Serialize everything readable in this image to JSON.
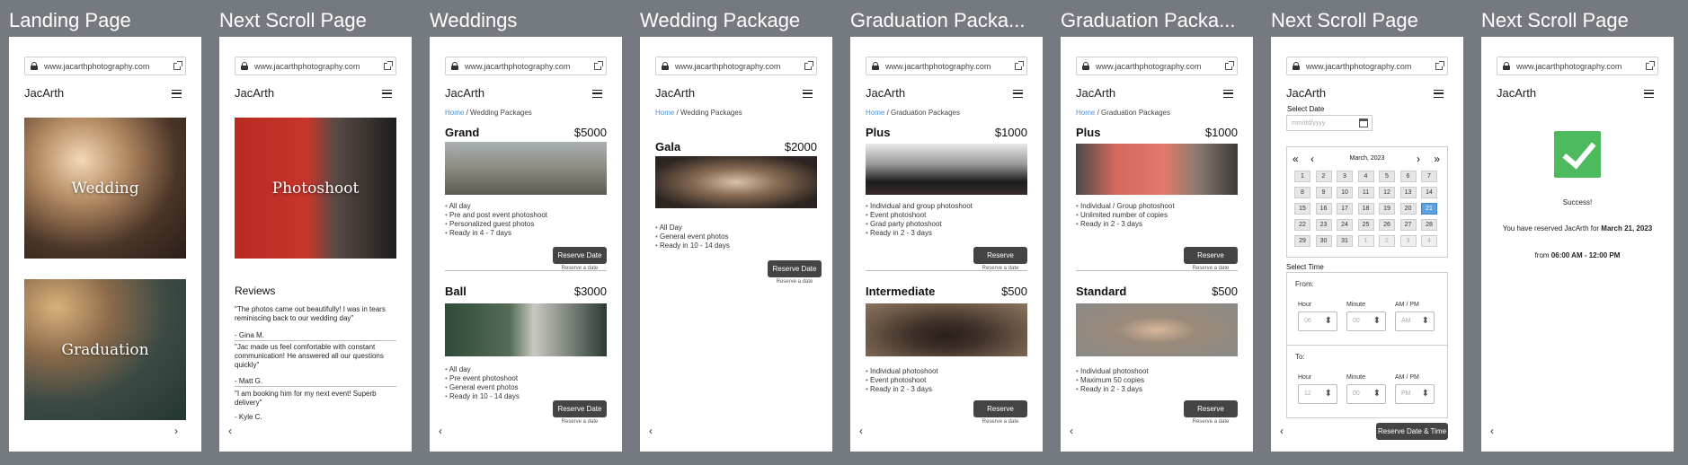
{
  "common": {
    "url": "www.jacarthphotography.com",
    "brand": "JacArth",
    "home": "Home",
    "next": "›",
    "prev": "‹"
  },
  "frames": [
    {
      "title": "Landing Page"
    },
    {
      "title": "Next Scroll Page"
    },
    {
      "title": "Weddings"
    },
    {
      "title": "Wedding Package"
    },
    {
      "title": "Graduation Packa..."
    },
    {
      "title": "Graduation Packa..."
    },
    {
      "title": "Next Scroll Page"
    },
    {
      "title": "Next Scroll Page"
    }
  ],
  "landing": {
    "wedding": "Wedding",
    "graduation": "Graduation"
  },
  "photoshoot": {
    "title": "Photoshoot",
    "reviews_title": "Reviews",
    "reviews": [
      {
        "text": "\"The photos came out beautifully! I was in tears reminiscing back to our wedding day\"",
        "author": "- Gina M."
      },
      {
        "text": "\"Jac made us feel comfortable with constant communication! He answered all our questions quickly\"",
        "author": "- Matt G."
      },
      {
        "text": "\"I am booking him for my next event! Superb delivery\"",
        "author": "- Kyle C."
      }
    ]
  },
  "weddings": {
    "crumb": "/ Wedding Packages",
    "grand": {
      "name": "Grand",
      "price": "$5000",
      "features": [
        "All day",
        "Pre and post event photoshoot",
        "Personalized guest photos",
        "Ready in 4 - 7 days"
      ]
    },
    "ball": {
      "name": "Ball",
      "price": "$3000",
      "features": [
        "All day",
        "Pre event photoshoot",
        "General event photos",
        "Ready in 10 - 14 days"
      ]
    },
    "button": "Reserve Date",
    "sub": "Reserve a date"
  },
  "wedding_pkg": {
    "crumb": "/ Wedding Packages",
    "gala": {
      "name": "Gala",
      "price": "$2000",
      "features": [
        "All Day",
        "General event photos",
        "Ready in 10 - 14 days"
      ]
    },
    "button": "Reserve Date",
    "sub": "Reserve a date"
  },
  "grad1": {
    "crumb": "/ Graduation Packages",
    "plus": {
      "name": "Plus",
      "price": "$1000",
      "features": [
        "Individual and group photoshoot",
        "Event photoshoot",
        "Grad party photoshoot",
        "Ready in 2 - 3 days"
      ]
    },
    "intermediate": {
      "name": "Intermediate",
      "price": "$500",
      "features": [
        "Individual photoshoot",
        "Event photoshoot",
        "Ready in 2 - 3 days"
      ]
    },
    "button": "Reserve",
    "sub": "Reserve a date"
  },
  "grad2": {
    "crumb": "/ Graduation Packages",
    "plus": {
      "name": "Plus",
      "price": "$1000",
      "features": [
        "Individual / Group photoshoot",
        "Unlimited number of copies",
        "Ready in 2 - 3 days"
      ]
    },
    "standard": {
      "name": "Standard",
      "price": "$500",
      "features": [
        "Individual photoshoot",
        "Maximum 50 copies",
        "Ready in 2 - 3 days"
      ]
    },
    "button": "Reserve",
    "sub": "Reserve a date"
  },
  "booking": {
    "select_date": "Select Date",
    "date_placeholder": "mm/dd/yyyy",
    "month": "March, 2023",
    "days": [
      "1",
      "2",
      "3",
      "4",
      "5",
      "6",
      "7",
      "8",
      "9",
      "10",
      "11",
      "12",
      "13",
      "14",
      "15",
      "16",
      "17",
      "18",
      "19",
      "20",
      "21",
      "22",
      "23",
      "24",
      "25",
      "26",
      "27",
      "28",
      "29",
      "30",
      "31",
      "1",
      "2",
      "3",
      "4"
    ],
    "selected_day": "21",
    "select_time": "Select Time",
    "from": "From:",
    "to": "To:",
    "hour": "Hour",
    "minute": "Minute",
    "ampm": "AM / PM",
    "from_vals": {
      "hour": "06",
      "minute": "00",
      "ampm": "AM"
    },
    "to_vals": {
      "hour": "12",
      "minute": "00",
      "ampm": "PM"
    },
    "button": "Reserve Date & Time"
  },
  "success": {
    "title": "Success!",
    "line1": "You have reserved JacArth for ",
    "line1_bold": "March 21, 2023",
    "line2": "from ",
    "line2_bold": "06:00 AM - 12:00 PM"
  },
  "colors": {
    "bg": "#757980",
    "button": "#444444",
    "link": "#4a8fd8",
    "selected": "#5aa2e0",
    "success": "#4dbb5d"
  }
}
